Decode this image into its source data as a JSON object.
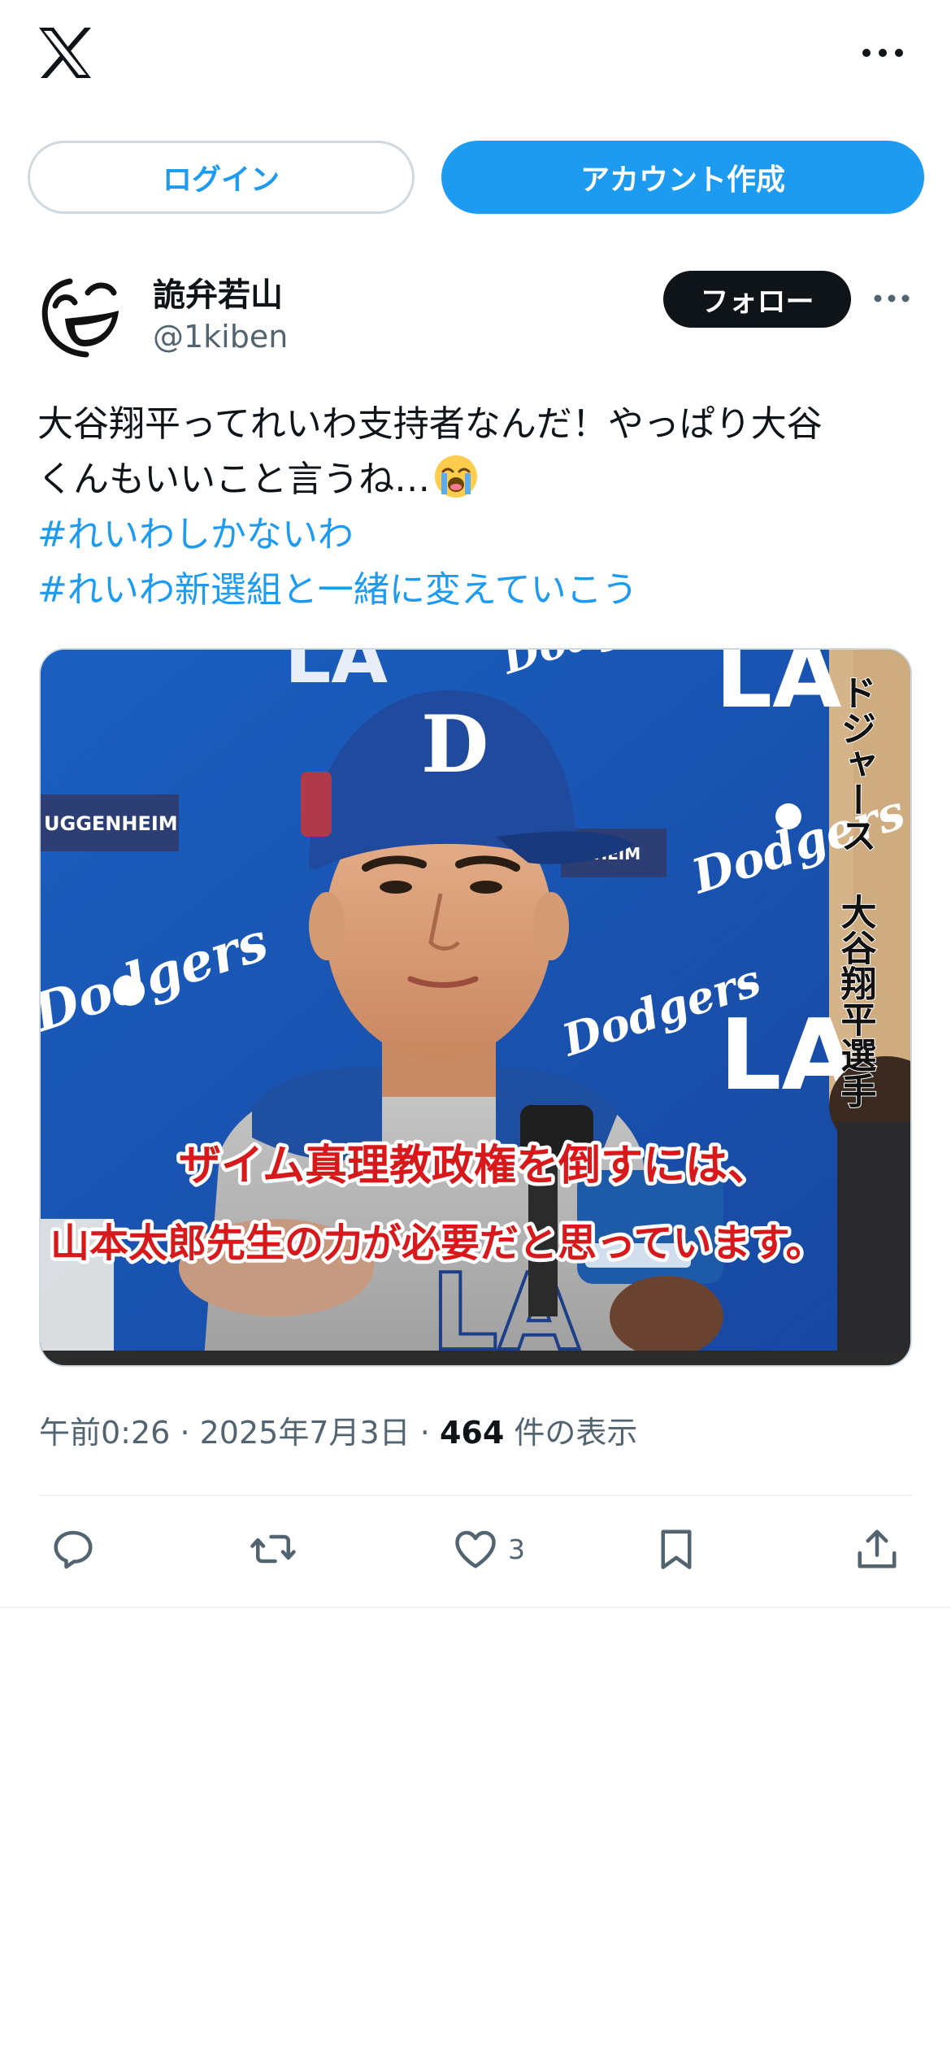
{
  "header": {
    "logo_icon": "x-logo-icon",
    "more_icon": "more-horizontal-icon"
  },
  "auth": {
    "login_label": "ログイン",
    "signup_label": "アカウント作成"
  },
  "post": {
    "author_name": "詭弁若山",
    "author_handle": "@1kiben",
    "follow_label": "フォロー",
    "text_line1": "大谷翔平ってれいわ支持者なんだ！やっぱり大谷",
    "text_line2": "くんもいいこと言うね…",
    "emoji": "loudly-crying-face",
    "hashtag1": "#れいわしかないわ",
    "hashtag2": "#れいわ新選組と一緒に変えていこう",
    "image": {
      "vertical_caption_1": "ドジャース",
      "vertical_caption_2": "大谷翔平選手",
      "subtitle_line1": "ザイム真理教政権を倒すには、",
      "subtitle_line2": "山本太郎先生の力が必要だと思っています。",
      "sponsor_left": "UGGENHEIM",
      "sponsor_mid": "ENHEIM",
      "backdrop_text": "Dodgers",
      "cap_letter": "D",
      "la_mark": "LA"
    },
    "time": "午前0:26",
    "separator": "·",
    "date": "2025年7月3日",
    "view_count": "464",
    "view_label": "件の表示",
    "actions": {
      "reply_icon": "reply-icon",
      "repost_icon": "repost-icon",
      "like_icon": "heart-icon",
      "like_count": "3",
      "bookmark_icon": "bookmark-icon",
      "share_icon": "share-icon"
    }
  },
  "colors": {
    "accent": "#1d9bf0",
    "text": "#0f1419",
    "secondary": "#536471",
    "border": "#cfd9de",
    "dodger_blue": "#1d4fa3",
    "subtitle_red": "#d7191b"
  }
}
